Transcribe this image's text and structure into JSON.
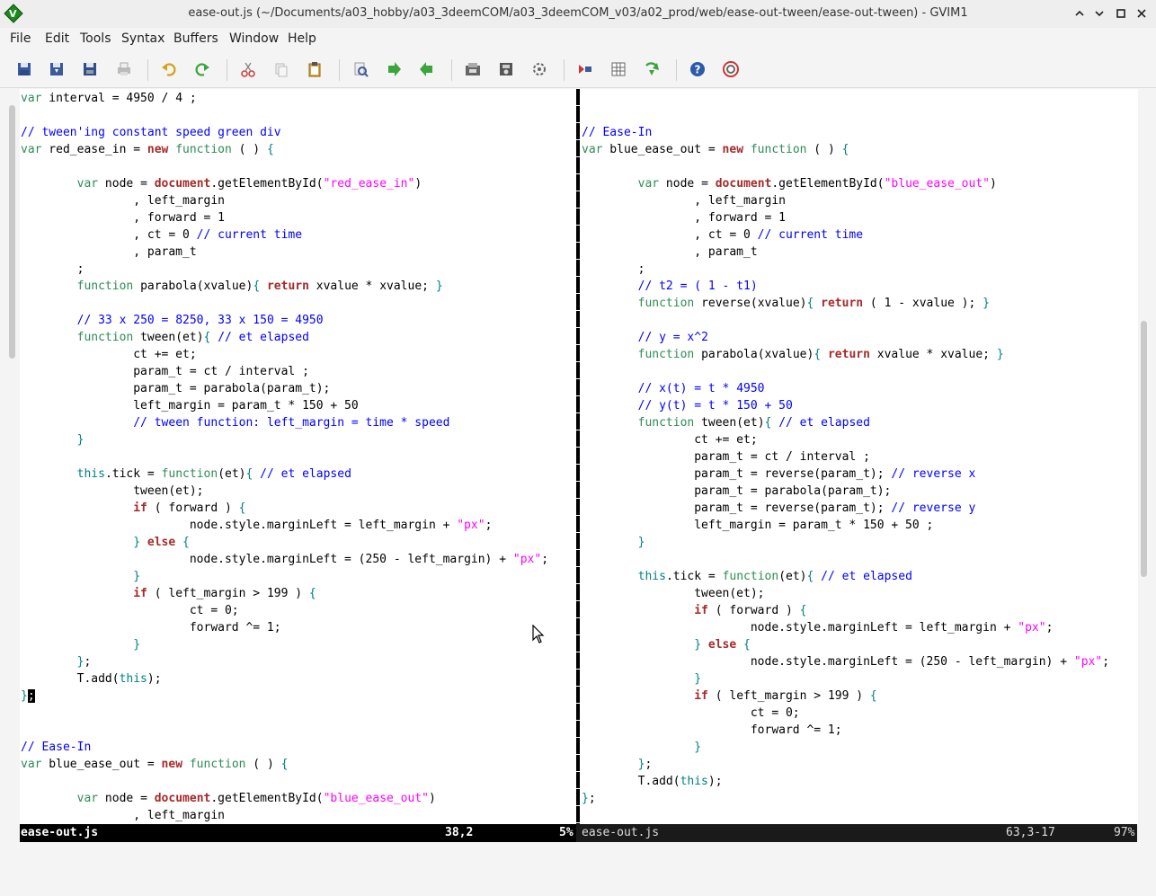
{
  "window": {
    "title": "ease-out.js (~/Documents/a03_hobby/a03_3deemCOM/a03_3deemCOM_v03/a02_prod/web/ease-out-tween/ease-out-tween) - GVIM1"
  },
  "menu": [
    "File",
    "Edit",
    "Tools",
    "Syntax",
    "Buffers",
    "Window",
    "Help"
  ],
  "toolbar_icons": [
    "open-icon",
    "save-icon",
    "save-all-icon",
    "print-icon",
    "undo-icon",
    "redo-icon",
    "cut-icon",
    "copy-icon",
    "paste-icon",
    "find-replace-icon",
    "find-next-icon",
    "find-prev-icon",
    "load-session-icon",
    "save-session-icon",
    "run-script-icon",
    "make-icon",
    "ctags-icon",
    "jump-tag-icon",
    "help-icon",
    "find-help-icon"
  ],
  "colors": {
    "keyword": "#a52a2a",
    "type": "#2e8b57",
    "comment": "#0000ff",
    "string": "#ff00ff",
    "special": "#008080"
  },
  "left_pane": {
    "lines": [
      "var interval = 4950 / 4 ;",
      "",
      "// tween'ing constant speed green div",
      "var red_ease_in = new function ( ) {",
      "",
      "        var node = document.getElementById(\"red_ease_in\")",
      "                , left_margin",
      "                , forward = 1",
      "                , ct = 0 // current time",
      "                , param_t",
      "        ;",
      "        function parabola(xvalue){ return xvalue * xvalue; }",
      "",
      "        // 33 x 250 = 8250, 33 x 150 = 4950",
      "        function tween(et){ // et elapsed",
      "                ct += et;",
      "                param_t = ct / interval ;",
      "                param_t = parabola(param_t);",
      "                left_margin = param_t * 150 + 50",
      "                // tween function: left_margin = time * speed",
      "        }",
      "",
      "        this.tick = function(et){ // et elapsed",
      "                tween(et);",
      "                if ( forward ) {",
      "                        node.style.marginLeft = left_margin + \"px\";",
      "                } else {",
      "                        node.style.marginLeft = (250 - left_margin) + \"px\";",
      "                }",
      "                if ( left_margin > 199 ) {",
      "                        ct = 0;",
      "                        forward ^= 1;",
      "                }",
      "        };",
      "        T.add(this);",
      "};",
      "",
      "",
      "// Ease-In",
      "var blue_ease_out = new function ( ) {",
      "",
      "        var node = document.getElementById(\"blue_ease_out\")",
      "                , left_margin"
    ],
    "cursor_line": 35,
    "cursor_col": 1
  },
  "right_pane": {
    "lines": [
      "",
      "",
      "// Ease-In",
      "var blue_ease_out = new function ( ) {",
      "",
      "        var node = document.getElementById(\"blue_ease_out\")",
      "                , left_margin",
      "                , forward = 1",
      "                , ct = 0 // current time",
      "                , param_t",
      "        ;",
      "        // t2 = ( 1 - t1)",
      "        function reverse(xvalue){ return ( 1 - xvalue ); }",
      "",
      "        // y = x^2",
      "        function parabola(xvalue){ return xvalue * xvalue; }",
      "",
      "        // x(t) = t * 4950",
      "        // y(t) = t * 150 + 50",
      "        function tween(et){ // et elapsed",
      "                ct += et;",
      "                param_t = ct / interval ;",
      "                param_t = reverse(param_t); // reverse x",
      "                param_t = parabola(param_t);",
      "                param_t = reverse(param_t); // reverse y",
      "                left_margin = param_t * 150 + 50 ;",
      "        }",
      "",
      "        this.tick = function(et){ // et elapsed",
      "                tween(et);",
      "                if ( forward ) {",
      "                        node.style.marginLeft = left_margin + \"px\";",
      "                } else {",
      "                        node.style.marginLeft = (250 - left_margin) + \"px\";",
      "                }",
      "                if ( left_margin > 199 ) {",
      "                        ct = 0;",
      "                        forward ^= 1;",
      "                }",
      "        };",
      "        T.add(this);",
      "};"
    ]
  },
  "status_left": {
    "filename": "ease-out.js",
    "position": "38,2",
    "percent": "5%"
  },
  "status_right": {
    "filename": "ease-out.js",
    "position": "63,3-17",
    "percent": "97%"
  }
}
